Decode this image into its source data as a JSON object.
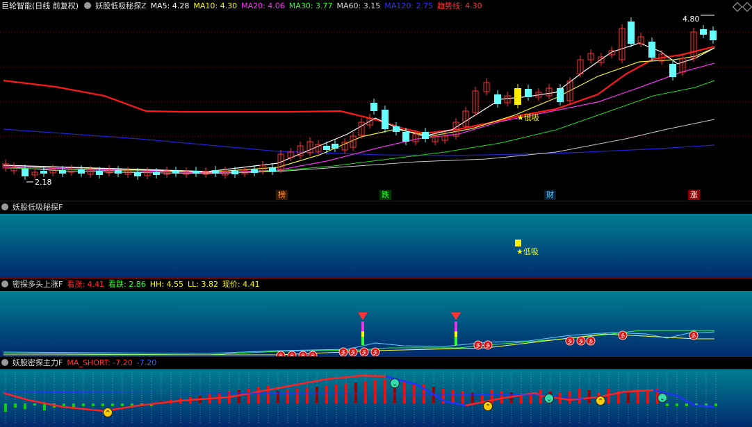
{
  "main": {
    "title": "巨轮智能(日线 前复权)",
    "indicator": "妖股低吸秘探Z",
    "ma": [
      {
        "label": "MA5: 4.28",
        "color": "#ffffff"
      },
      {
        "label": "MA10: 4.30",
        "color": "#ffff00"
      },
      {
        "label": "MA20: 4.06",
        "color": "#ff33ff"
      },
      {
        "label": "MA30: 3.77",
        "color": "#33ff33"
      },
      {
        "label": "MA60: 3.15",
        "color": "#dddddd"
      },
      {
        "label": "MA120: 2.75",
        "color": "#3333ff"
      },
      {
        "label": "趋势线: 4.30",
        "color": "#ff3333"
      }
    ],
    "high_label": "4.80",
    "low_label": "2.18",
    "signal_label": "低吸",
    "badges": [
      {
        "text": "榜",
        "color": "#ff9933",
        "bg": "#3a1a00"
      },
      {
        "text": "跌",
        "color": "#33ff33",
        "bg": "#003a00"
      },
      {
        "text": "财",
        "color": "#66ccff",
        "bg": "#00203a"
      },
      {
        "text": "涨",
        "color": "#ffffff",
        "bg": "#8b0000"
      }
    ]
  },
  "panel2": {
    "title": "妖股低吸秘探F",
    "signal_label": "低吸"
  },
  "panel3": {
    "title": "密探多头上涨F",
    "values": [
      {
        "label": "看涨: 4.41",
        "color": "#ff3333"
      },
      {
        "label": "看跌: 2.86",
        "color": "#33ff33"
      },
      {
        "label": "HH: 4.55",
        "color": "#ffff00"
      },
      {
        "label": "LL: 3.82",
        "color": "#ffff00"
      },
      {
        "label": "现价: 4.41",
        "color": "#ffff00"
      }
    ],
    "marker_text": "多"
  },
  "panel4": {
    "title": "妖股密探主力F",
    "values": [
      {
        "label": "MA_SHORT: -7.20",
        "color": "#ff3333"
      },
      {
        "label": "-7.20",
        "color": "#3366ff"
      }
    ]
  }
}
